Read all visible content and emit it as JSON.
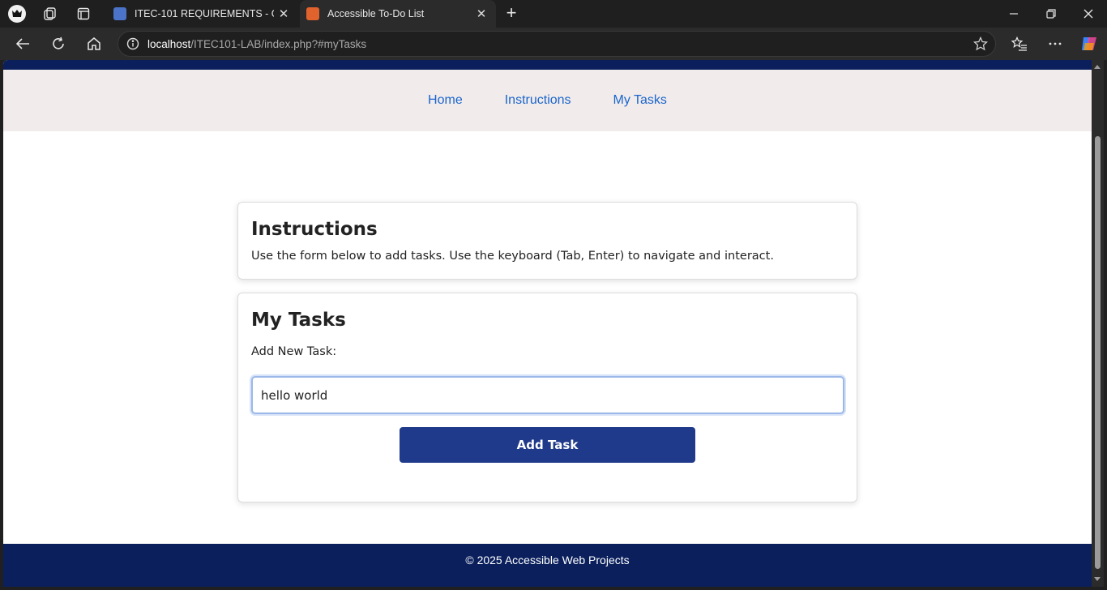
{
  "browser": {
    "tabs": [
      {
        "title": "ITEC-101 REQUIREMENTS - Goog",
        "active": false
      },
      {
        "title": "Accessible To-Do List",
        "active": true
      }
    ],
    "address": {
      "host": "localhost",
      "path": "/ITEC101-LAB/index.php?#myTasks"
    },
    "icons": {
      "profile": "profile-icon",
      "workspaces": "workspaces-icon",
      "tab_actions": "tab-actions-icon",
      "back": "back-arrow-icon",
      "refresh": "refresh-icon",
      "home": "home-icon",
      "info": "site-info-icon",
      "favorite": "star-icon",
      "favorites_list": "favorites-icon",
      "more": "more-icon",
      "copilot": "copilot-icon"
    }
  },
  "site": {
    "nav": [
      {
        "label": "Home"
      },
      {
        "label": "Instructions"
      },
      {
        "label": "My Tasks"
      }
    ],
    "instructions": {
      "heading": "Instructions",
      "text": "Use the form below to add tasks. Use the keyboard (Tab, Enter) to navigate and interact."
    },
    "tasks": {
      "heading": "My Tasks",
      "input_label": "Add New Task:",
      "input_value": "hello world",
      "button_label": "Add Task"
    },
    "footer": "© 2025 Accessible Web Projects"
  },
  "colors": {
    "brand_dark": "#0a1f5c",
    "button": "#1f3a8a",
    "link": "#1a66cc",
    "nav_bg": "#f2ebeb"
  }
}
